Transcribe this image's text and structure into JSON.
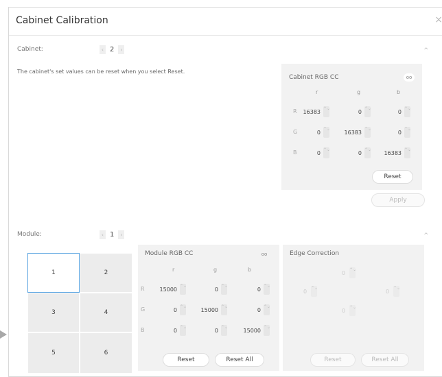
{
  "window": {
    "title": "Cabinet Calibration",
    "close_glyph": "×"
  },
  "cabinet": {
    "label": "Cabinet:",
    "value": "2",
    "description": "The cabinet's set values can be reset when you select Reset.",
    "collapse_glyph": "^",
    "rgb_cc": {
      "title": "Cabinet RGB CC",
      "columns": [
        "r",
        "g",
        "b"
      ],
      "rows": [
        {
          "label": "R",
          "values": [
            "16383",
            "0",
            "0"
          ]
        },
        {
          "label": "G",
          "values": [
            "0",
            "16383",
            "0"
          ]
        },
        {
          "label": "B",
          "values": [
            "0",
            "0",
            "16383"
          ]
        }
      ],
      "reset_label": "Reset",
      "apply_label": "Apply"
    }
  },
  "module": {
    "label": "Module:",
    "value": "1",
    "collapse_glyph": "^",
    "grid": [
      "1",
      "2",
      "3",
      "4",
      "5",
      "6"
    ],
    "selected": "1",
    "rgb_cc": {
      "title": "Module RGB CC",
      "columns": [
        "r",
        "g",
        "b"
      ],
      "rows": [
        {
          "label": "R",
          "values": [
            "15000",
            "0",
            "0"
          ]
        },
        {
          "label": "G",
          "values": [
            "0",
            "15000",
            "0"
          ]
        },
        {
          "label": "B",
          "values": [
            "0",
            "0",
            "15000"
          ]
        }
      ],
      "reset_label": "Reset",
      "reset_all_label": "Reset All"
    },
    "edge": {
      "title": "Edge Correction",
      "top": "0",
      "left": "0",
      "right": "0",
      "bottom": "0",
      "reset_label": "Reset",
      "reset_all_label": "Reset All"
    }
  },
  "icons": {
    "chain": "link-icon",
    "prev": "chevron-left-icon",
    "next": "chevron-right-icon",
    "spin": "spinner-icon"
  }
}
